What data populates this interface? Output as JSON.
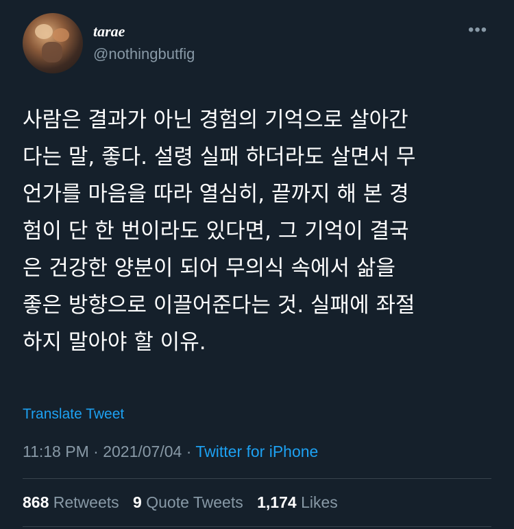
{
  "author": {
    "display_name": "tarae",
    "handle": "@nothingbutfig"
  },
  "menu_icon": "more-horizontal-icon",
  "tweet": {
    "lines": [
      "사람은 결과가 아닌 경험의 기억으로 살아간",
      "다는 말, 좋다. 설령 실패 하더라도 살면서 무",
      "언가를 마음을 따라 열심히, 끝까지 해 본 경",
      "험이 단 한 번이라도 있다면, 그 기억이 결국",
      "은 건강한 양분이 되어 무의식 속에서 삶을",
      "좋은 방향으로 이끌어준다는 것. 실패에 좌절",
      "하지 말아야 할 이유."
    ],
    "translate_label": "Translate Tweet",
    "time": "11:18 PM",
    "separator": "·",
    "date": "2021/07/04",
    "source": "Twitter for iPhone"
  },
  "stats": {
    "retweets_count": "868",
    "retweets_label": "Retweets",
    "quotes_count": "9",
    "quotes_label": "Quote Tweets",
    "likes_count": "1,174",
    "likes_label": "Likes"
  },
  "colors": {
    "background": "#15202b",
    "text": "#ffffff",
    "secondary": "#8899a6",
    "accent": "#1da1f2",
    "divider": "#38444d"
  }
}
